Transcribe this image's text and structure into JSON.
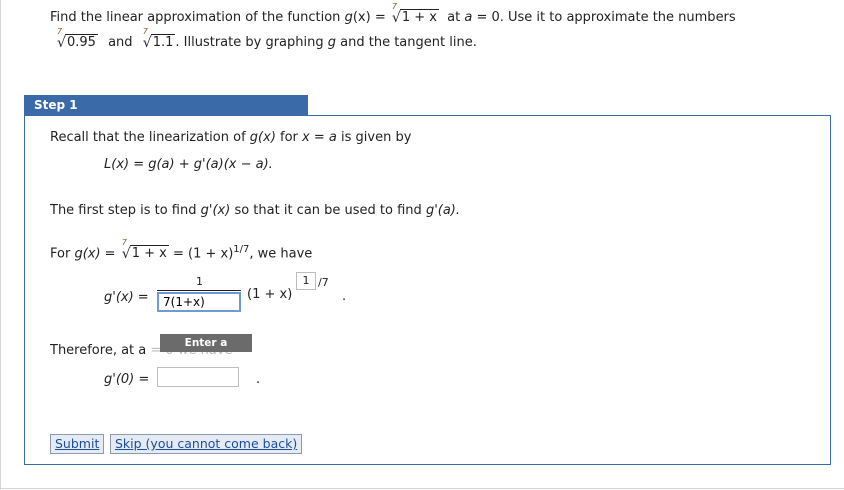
{
  "question": {
    "prefix": "Find the linear approximation of the function",
    "func_name": "g",
    "func_var": "(x) =",
    "root_index": "7",
    "radicand": "1 + x",
    "at_text": "at",
    "a_var": "a",
    "at_value": "= 0. Use it to approximate the numbers",
    "num1": "0.95",
    "and_text": "and",
    "num2": "1.1",
    "suffix": ". Illustrate by graphing",
    "g_text": "g",
    "suffix2": "and the tangent line."
  },
  "step": {
    "title": "Step 1",
    "recall_prefix": "Recall that the linearization of",
    "recall_gx": "g(x)",
    "recall_mid": "for",
    "recall_x_eq_a": "x = a",
    "recall_suffix": "is given by",
    "linearization": "L(x) = g(a) + g'(a)(x − a).",
    "first_step_prefix": "The first step is to find",
    "first_step_gpx": "g'(x)",
    "first_step_mid": "so that it can be used to find",
    "first_step_gpa": "g'(a).",
    "for_prefix": "For",
    "for_gx": "g(x) =",
    "for_radicand": "1 + x",
    "for_eq": "= (1 + x)",
    "for_exp": "1/7",
    "for_suffix": ", we have",
    "gprime_label": "g'(x) =",
    "frac_numerator": "1",
    "frac_denominator_value": "7(1+x)",
    "base_expr": "(1 + x)",
    "exp_box_value": "1",
    "exp_suffix": "/7",
    "period": ".",
    "therefore_text": "Therefore, at a",
    "therefore_hidden": "= 0 we have",
    "gprime0_label": "g'(0) =",
    "gprime0_value": "",
    "period2": ".",
    "tooltip": "Enter a number."
  },
  "buttons": {
    "submit": "Submit",
    "skip": "Skip (you cannot come back)"
  }
}
